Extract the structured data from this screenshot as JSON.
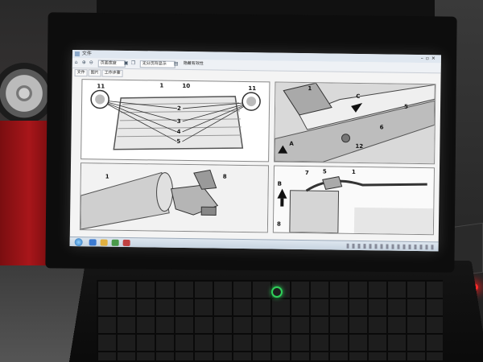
{
  "window": {
    "title": "文件"
  },
  "toolbar": {
    "view_select": "页面宽度",
    "display_select": "无分页符显示",
    "hide_link": "隐藏有效性"
  },
  "tabs": [
    {
      "label": "文件"
    },
    {
      "label": "图片"
    },
    {
      "label": "工作步骤"
    }
  ],
  "figure": {
    "panel1_callouts": [
      "11",
      "1",
      "10",
      "11",
      "2",
      "3",
      "4",
      "5"
    ],
    "panel2_callouts": [
      "1",
      "C",
      "5",
      "6",
      "12",
      "A"
    ],
    "panel3_callouts": [
      "1",
      "8"
    ],
    "panel4_callouts": [
      "7",
      "5",
      "1",
      "B",
      "8"
    ]
  },
  "colors": {
    "screen_bg": "#f4f4f4",
    "power_led": "#2fd15a",
    "status_led": "#ff2a2a",
    "cart": "#a8161a"
  }
}
